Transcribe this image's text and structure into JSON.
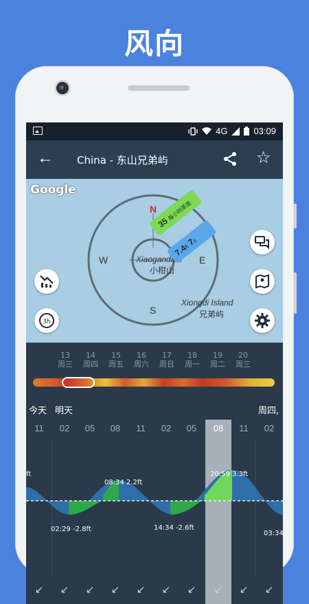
{
  "promo": {
    "title": "风向"
  },
  "status": {
    "network": "4G",
    "time": "03:09"
  },
  "appbar": {
    "title": "China - 东山兄弟屿"
  },
  "map": {
    "google_label": "Google",
    "compass": {
      "n": "N",
      "e": "E",
      "s": "S",
      "w": "W"
    },
    "place1": {
      "name_en": "Xiaogandian",
      "name_zh": "小柑山"
    },
    "place2": {
      "name_en": "Xiongdi Island",
      "name_zh": "兄弟屿"
    },
    "wind_badge": {
      "value": "35",
      "unit": "每小时英里"
    },
    "wave_badge": {
      "value": "7.4",
      "unit": "ft",
      "period": "7",
      "period_unit": "s"
    }
  },
  "days": [
    {
      "num": "13",
      "name": "周三"
    },
    {
      "num": "14",
      "name": "周四"
    },
    {
      "num": "15",
      "name": "周五"
    },
    {
      "num": "16",
      "name": "周六"
    },
    {
      "num": "17",
      "name": "周日"
    },
    {
      "num": "18",
      "name": "周一"
    },
    {
      "num": "19",
      "name": "周二"
    },
    {
      "num": "20",
      "name": "周三"
    }
  ],
  "timeline": {
    "today": "今天",
    "tomorrow": "明天",
    "thursday": "周四,",
    "hours": [
      "11",
      "02",
      "05",
      "08",
      "11",
      "02",
      "05",
      "08",
      "11",
      "02"
    ],
    "arrows": [
      "↙",
      "↙",
      "↙",
      "↙",
      "↙",
      "↙",
      "↙",
      "↙",
      "↙",
      "↙"
    ]
  },
  "tide_labels": {
    "left_edge": "ft",
    "low1": "02:29 -2.8ft",
    "high1": "08:34 2.2ft",
    "low2": "14:34 -2.6ft",
    "high2": "20:59 3.3ft",
    "right_edge": "03:34"
  },
  "colors": {
    "promo_bg": "#4a82dd",
    "appbar": "#2b3e52",
    "map_water": "#a9cde3",
    "wind_badge": "#7ed957",
    "wave_badge": "#5aa7e8"
  }
}
